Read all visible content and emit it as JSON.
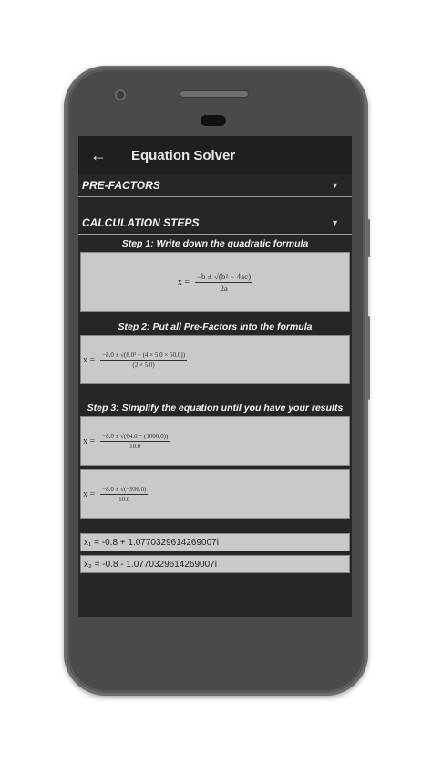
{
  "app": {
    "title": "Equation Solver",
    "back_icon": "arrow-left-icon"
  },
  "sections": {
    "prefactors": "PRE-FACTORS",
    "steps": "CALCULATION STEPS"
  },
  "steps": {
    "step1_label": "Step 1: Write down the quadratic formula",
    "step1_lhs": "x =",
    "step1_num": "−b ± √(b² − 4ac)",
    "step1_den": "2a",
    "step2_label": "Step 2: Put all Pre-Factors into the formula",
    "step2_lhs": "x =",
    "step2_num": "−8.0 ± √(8.0² − (4 × 5.0 × 50.0))",
    "step2_den": "(2 × 5.0)",
    "step3_label": "Step 3: Simplify the equation until you have your results",
    "step3a_lhs": "x =",
    "step3a_num": "−8.0 ± √(64.0 − (1000.0))",
    "step3a_den": "10.0",
    "step3b_lhs": "x =",
    "step3b_num": "−8.0 ± √(−936.0)",
    "step3b_den": "10.0"
  },
  "results": {
    "x1": "x₁ = -0.8 + 1.0770329614269007i",
    "x2": "x₂ = -0.8 - 1.0770329614269007i"
  }
}
